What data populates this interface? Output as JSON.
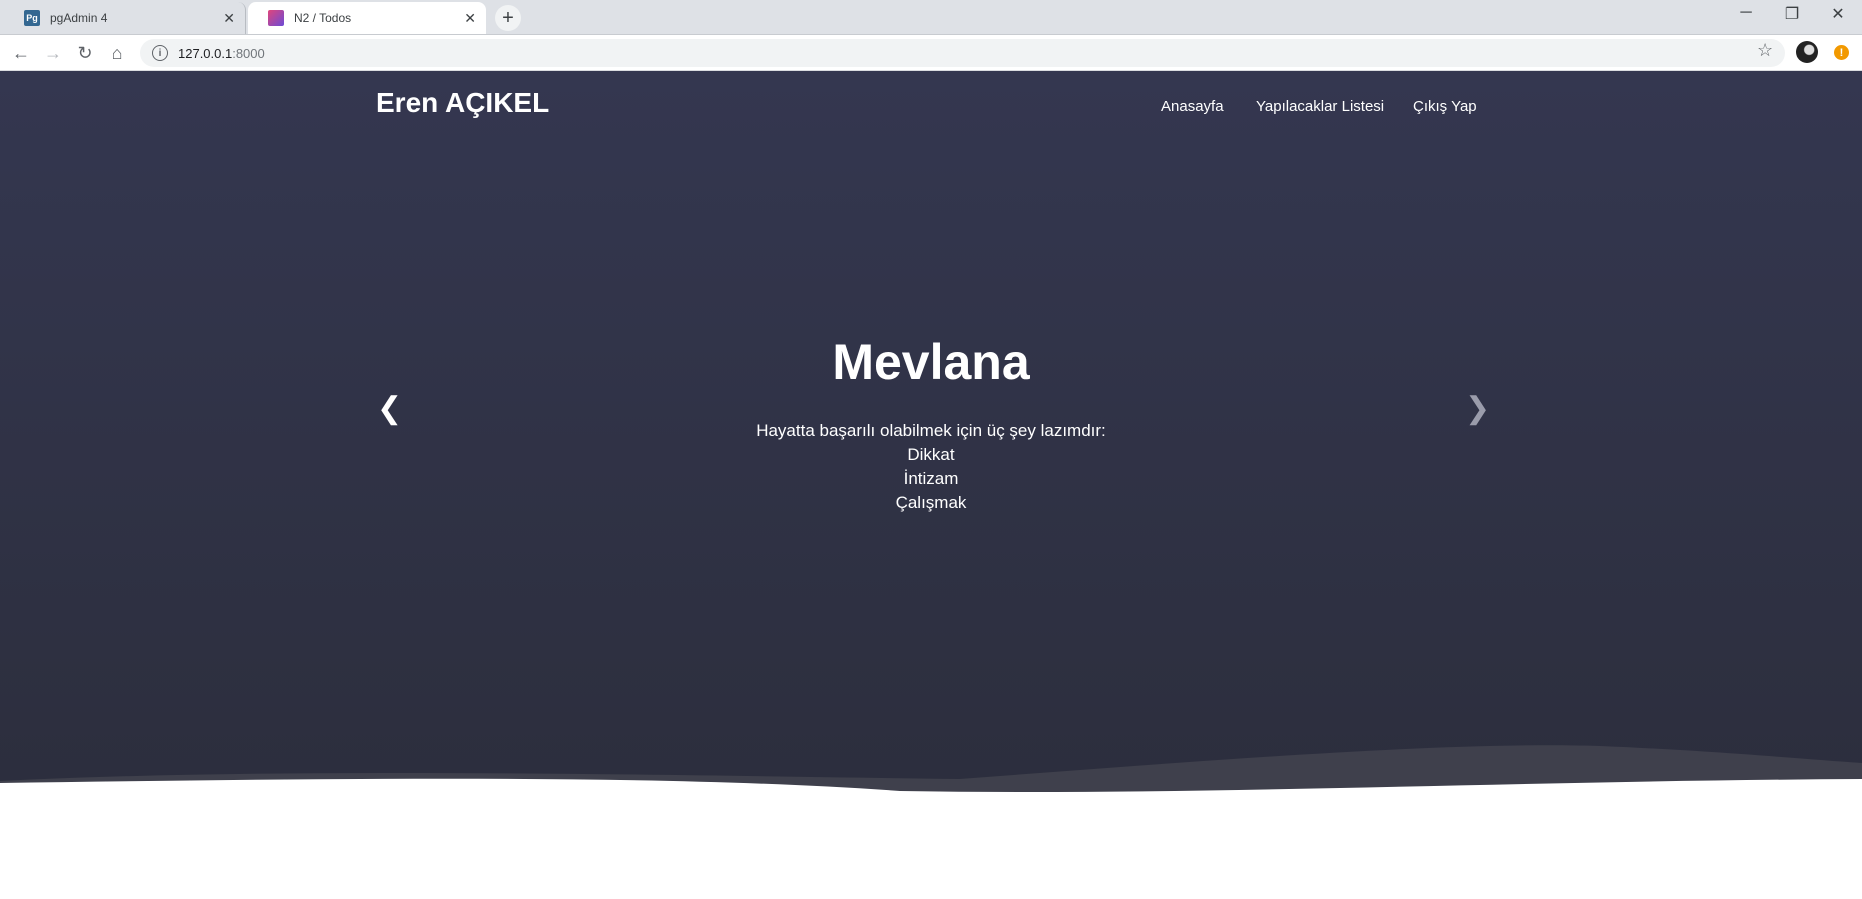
{
  "browser": {
    "tabs": [
      {
        "title": "pgAdmin 4",
        "favicon": "Pg"
      },
      {
        "title": "N2 / Todos",
        "favicon": ""
      }
    ],
    "url_host": "127.0.0.1",
    "url_port": ":8000"
  },
  "site": {
    "brand": "Eren AÇIKEL",
    "nav": [
      "Anasayfa",
      "Yapılacaklar Listesi",
      "Çıkış Yap"
    ]
  },
  "slide": {
    "title": "Mevlana",
    "lines": [
      "Hayatta başarılı olabilmek için üç şey lazımdır:",
      "Dikkat",
      "İntizam",
      "Çalışmak"
    ]
  },
  "colors": {
    "hero_top": "#343750",
    "hero_bottom": "#2c2e3d"
  }
}
